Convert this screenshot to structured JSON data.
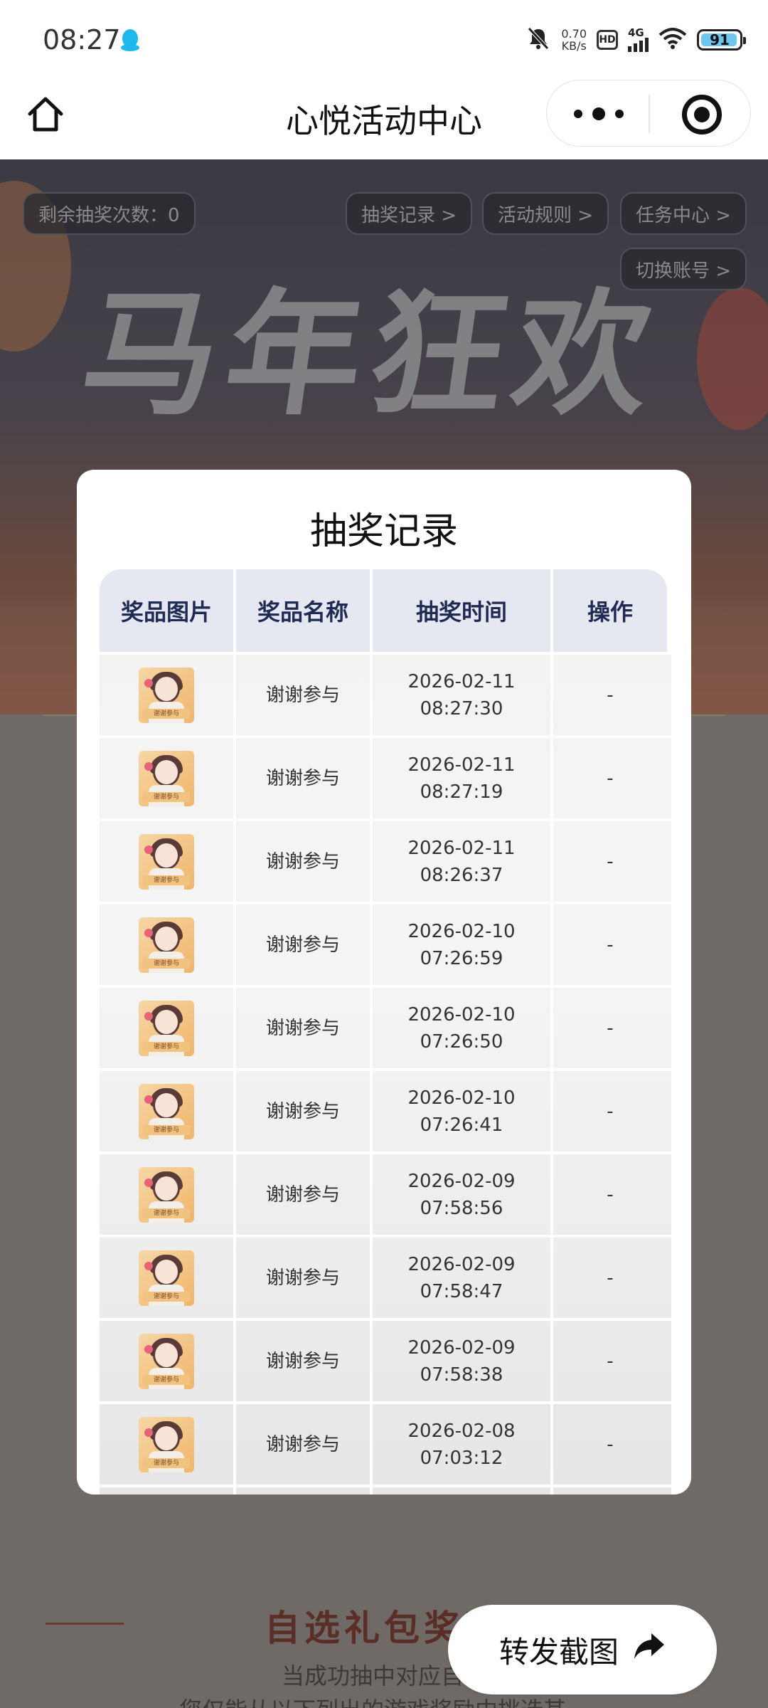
{
  "status_bar": {
    "time": "08:27",
    "net_speed_value": "0.70",
    "net_speed_unit": "KB/s",
    "hd": "HD",
    "signal_type": "4G",
    "battery": "91"
  },
  "nav": {
    "title": "心悦活动中心"
  },
  "banner": {
    "remaining_label": "剩余抽奖次数：0",
    "lottery_records_link": "抽奖记录 >",
    "activity_rules_link": "活动规则 >",
    "task_center_link": "任务中心 >",
    "switch_account_link": "切换账号 >",
    "headline": "马年狂欢"
  },
  "modal": {
    "title": "抽奖记录",
    "headers": {
      "image": "奖品图片",
      "name": "奖品名称",
      "time": "抽奖时间",
      "action": "操作"
    },
    "prize_image_caption": "谢谢参与",
    "rows": [
      {
        "name": "谢谢参与",
        "date": "2026-02-11",
        "clock": "08:27:30",
        "action": "-"
      },
      {
        "name": "谢谢参与",
        "date": "2026-02-11",
        "clock": "08:27:19",
        "action": "-"
      },
      {
        "name": "谢谢参与",
        "date": "2026-02-11",
        "clock": "08:26:37",
        "action": "-"
      },
      {
        "name": "谢谢参与",
        "date": "2026-02-10",
        "clock": "07:26:59",
        "action": "-"
      },
      {
        "name": "谢谢参与",
        "date": "2026-02-10",
        "clock": "07:26:50",
        "action": "-"
      },
      {
        "name": "谢谢参与",
        "date": "2026-02-10",
        "clock": "07:26:41",
        "action": "-"
      },
      {
        "name": "谢谢参与",
        "date": "2026-02-09",
        "clock": "07:58:56",
        "action": "-"
      },
      {
        "name": "谢谢参与",
        "date": "2026-02-09",
        "clock": "07:58:47",
        "action": "-"
      },
      {
        "name": "谢谢参与",
        "date": "2026-02-09",
        "clock": "07:58:38",
        "action": "-"
      },
      {
        "name": "谢谢参与",
        "date": "2026-02-08",
        "clock": "07:03:12",
        "action": "-"
      }
    ]
  },
  "background_section": {
    "title": "自选礼包奖励",
    "line1": "当成功抽中对应自选",
    "line2": "您仅能从以下列出的游戏奖励中挑选其一"
  },
  "share_button": {
    "label": "转发截图",
    "icon": "share-arrow-icon"
  },
  "colors": {
    "header_bg": "#e6e8f1",
    "header_text": "#1f2a55",
    "battery_fill": "#6cc6ef",
    "qq_icon": "#1fb8ee"
  }
}
